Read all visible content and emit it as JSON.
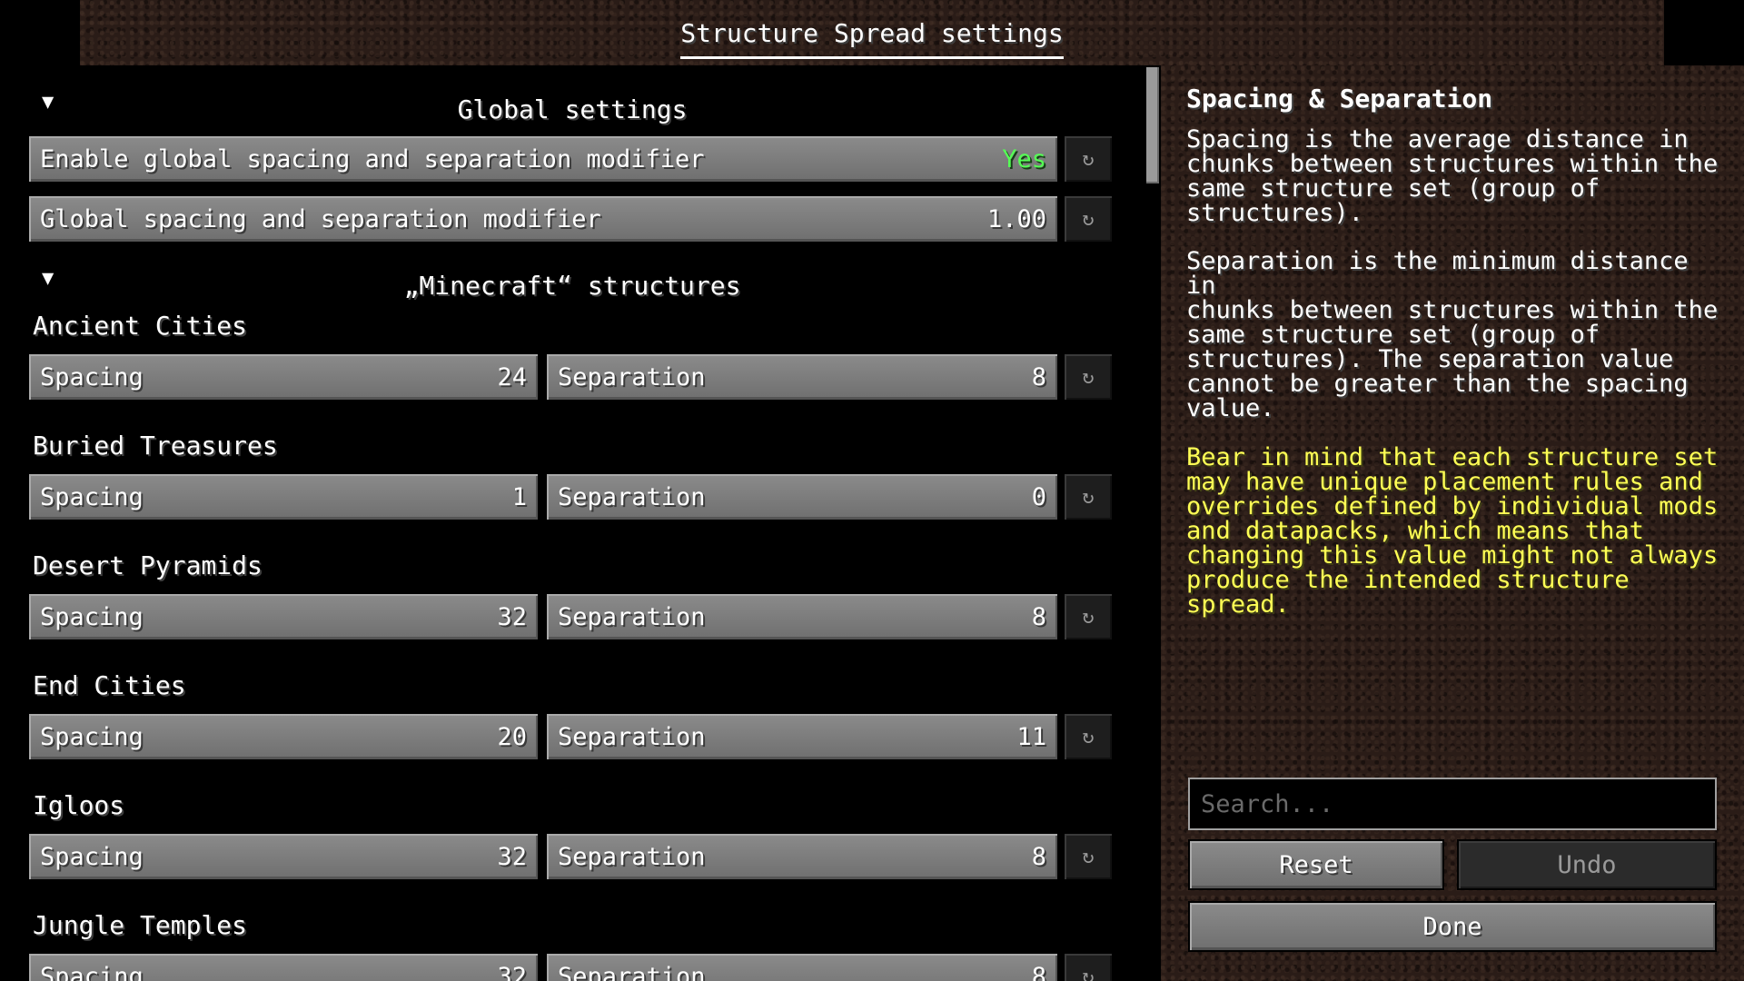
{
  "header": {
    "tab_title": "Structure Spread settings"
  },
  "global": {
    "section_title": "Global settings",
    "enable_label": "Enable global spacing and separation modifier",
    "enable_value": "Yes",
    "modifier_label": "Global spacing and separation modifier",
    "modifier_value": "1.00"
  },
  "minecraft": {
    "section_title": "„Minecraft“ structures",
    "spacing_label": "Spacing",
    "separation_label": "Separation",
    "groups": [
      {
        "name": "Ancient Cities",
        "spacing": "24",
        "separation": "8"
      },
      {
        "name": "Buried Treasures",
        "spacing": "1",
        "separation": "0"
      },
      {
        "name": "Desert Pyramids",
        "spacing": "32",
        "separation": "8"
      },
      {
        "name": "End Cities",
        "spacing": "20",
        "separation": "11"
      },
      {
        "name": "Igloos",
        "spacing": "32",
        "separation": "8"
      },
      {
        "name": "Jungle Temples",
        "spacing": "32",
        "separation": "8"
      }
    ]
  },
  "icons": {
    "section_toggle": "triangle-down-icon",
    "reset": "reset-arrow-icon"
  },
  "info": {
    "title": "Spacing & Separation",
    "para1": "Spacing is the average distance in\nchunks between structures within the\nsame structure set (group of\nstructures).",
    "para2": "Separation is the minimum distance in\nchunks between structures within the\nsame structure set (group of\nstructures). The separation value\ncannot be greater than the spacing\nvalue.",
    "warning": "Bear in mind that each structure set\nmay have unique placement rules and\noverrides defined by individual mods\nand datapacks, which means that\nchanging this value might not always\nproduce the intended structure\nspread."
  },
  "controls": {
    "search_placeholder": "Search...",
    "reset_label": "Reset",
    "undo_label": "Undo",
    "done_label": "Done"
  },
  "colors": {
    "yes_green": "#55ff55",
    "warning_yellow": "#ffff55"
  }
}
